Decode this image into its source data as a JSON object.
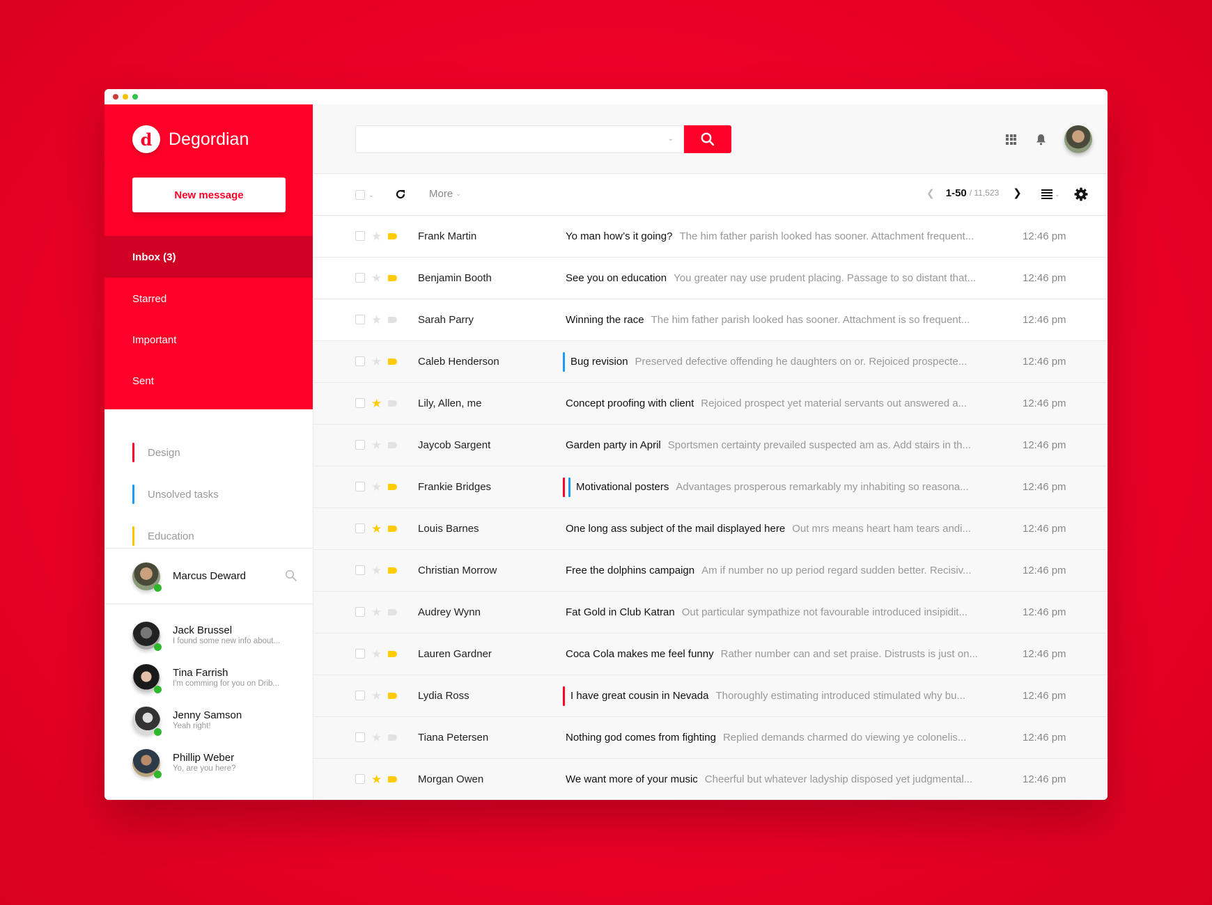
{
  "window": {
    "controls": [
      "close",
      "minimize",
      "maximize"
    ]
  },
  "brand": {
    "name": "Degordian",
    "logo_glyph": "d"
  },
  "sidebar": {
    "new_message_label": "New message",
    "nav": [
      {
        "label": "Inbox (3)",
        "active": true
      },
      {
        "label": "Starred",
        "active": false
      },
      {
        "label": "Important",
        "active": false
      },
      {
        "label": "Sent",
        "active": false
      }
    ],
    "labels": [
      {
        "label": "Design",
        "color": "#ff0029"
      },
      {
        "label": "Unsolved tasks",
        "color": "#1a9bfc"
      },
      {
        "label": "Education",
        "color": "#ffc400"
      }
    ],
    "current_user": {
      "name": "Marcus Deward",
      "online": true,
      "search_icon": "search-icon"
    },
    "contacts": [
      {
        "name": "Jack Brussel",
        "message": "I found some new info about...",
        "online": true
      },
      {
        "name": "Tina Farrish",
        "message": "I'm comming for you on Drib...",
        "online": true
      },
      {
        "name": "Jenny Samson",
        "message": "Yeah right!",
        "online": true
      },
      {
        "name": "Phillip Weber",
        "message": "Yo, are you here?",
        "online": true
      }
    ]
  },
  "header": {
    "search": {
      "value": "",
      "placeholder": ""
    },
    "icons": [
      "apps-grid-icon",
      "bell-icon",
      "user-avatar"
    ]
  },
  "toolbar": {
    "more_label": "More",
    "pagination": {
      "range": "1-50",
      "total": "/ 11,523"
    }
  },
  "colors": {
    "brand": "#ff0029",
    "brand_dark": "#d00024",
    "star": "#ffcc00",
    "tag_yellow": "#ffcc00",
    "tag_off": "#e2e2e2",
    "label_red": "#ff0029",
    "label_blue": "#1a9bfc",
    "online": "#2fb82b"
  },
  "emails": [
    {
      "sender": "Frank Martin",
      "subject": "Yo man how’s it going?",
      "preview": "The him father parish looked has sooner. Attachment frequent...",
      "time": "12:46 pm",
      "starred": false,
      "tagged": true,
      "unread": true,
      "marks": []
    },
    {
      "sender": "Benjamin Booth",
      "subject": "See you on education",
      "preview": "You greater nay use prudent placing. Passage to so distant that...",
      "time": "12:46 pm",
      "starred": false,
      "tagged": true,
      "unread": true,
      "marks": []
    },
    {
      "sender": "Sarah Parry",
      "subject": "Winning the race",
      "preview": "The him father parish looked has sooner. Attachment is so frequent...",
      "time": "12:46 pm",
      "starred": false,
      "tagged": false,
      "unread": true,
      "marks": []
    },
    {
      "sender": "Caleb Henderson",
      "subject": "Bug revision",
      "preview": "Preserved defective offending he daughters on or. Rejoiced prospecte...",
      "time": "12:46 pm",
      "starred": false,
      "tagged": true,
      "unread": false,
      "marks": [
        "#1a9bfc"
      ]
    },
    {
      "sender": "Lily, Allen, me",
      "subject": "Concept proofing with client",
      "preview": "Rejoiced prospect yet material servants out answered a...",
      "time": "12:46 pm",
      "starred": true,
      "tagged": false,
      "unread": false,
      "marks": []
    },
    {
      "sender": "Jaycob Sargent",
      "subject": "Garden party in April",
      "preview": "Sportsmen certainty prevailed suspected am as. Add stairs in th...",
      "time": "12:46 pm",
      "starred": false,
      "tagged": false,
      "unread": false,
      "marks": []
    },
    {
      "sender": "Frankie Bridges",
      "subject": "Motivational posters",
      "preview": "Advantages prosperous remarkably my inhabiting so reasona...",
      "time": "12:46 pm",
      "starred": false,
      "tagged": true,
      "unread": false,
      "marks": [
        "#ff0029",
        "#1a9bfc"
      ]
    },
    {
      "sender": "Louis Barnes",
      "subject": "One long ass subject of the mail displayed here",
      "preview": "Out mrs means heart ham tears andi...",
      "time": "12:46 pm",
      "starred": true,
      "tagged": true,
      "unread": false,
      "marks": []
    },
    {
      "sender": "Christian Morrow",
      "subject": "Free the dolphins campaign",
      "preview": "Am if number no up period regard sudden better. Recisiv...",
      "time": "12:46 pm",
      "starred": false,
      "tagged": true,
      "unread": false,
      "marks": []
    },
    {
      "sender": "Audrey Wynn",
      "subject": "Fat Gold in Club Katran",
      "preview": "Out particular sympathize not favourable introduced insipidit...",
      "time": "12:46 pm",
      "starred": false,
      "tagged": false,
      "unread": false,
      "marks": []
    },
    {
      "sender": "Lauren Gardner",
      "subject": "Coca Cola makes me feel funny",
      "preview": "Rather number can and set praise. Distrusts is just on...",
      "time": "12:46 pm",
      "starred": false,
      "tagged": true,
      "unread": false,
      "marks": []
    },
    {
      "sender": "Lydia Ross",
      "subject": "I have great cousin in Nevada",
      "preview": "Thoroughly estimating introduced stimulated why bu...",
      "time": "12:46 pm",
      "starred": false,
      "tagged": true,
      "unread": false,
      "marks": [
        "#ff0029"
      ]
    },
    {
      "sender": "Tiana Petersen",
      "subject": "Nothing god comes from fighting",
      "preview": "Replied demands charmed do viewing ye colonelis...",
      "time": "12:46 pm",
      "starred": false,
      "tagged": false,
      "unread": false,
      "marks": []
    },
    {
      "sender": "Morgan Owen",
      "subject": "We want more of your music",
      "preview": "Cheerful but whatever ladyship disposed yet judgmental...",
      "time": "12:46 pm",
      "starred": true,
      "tagged": true,
      "unread": false,
      "marks": []
    }
  ]
}
